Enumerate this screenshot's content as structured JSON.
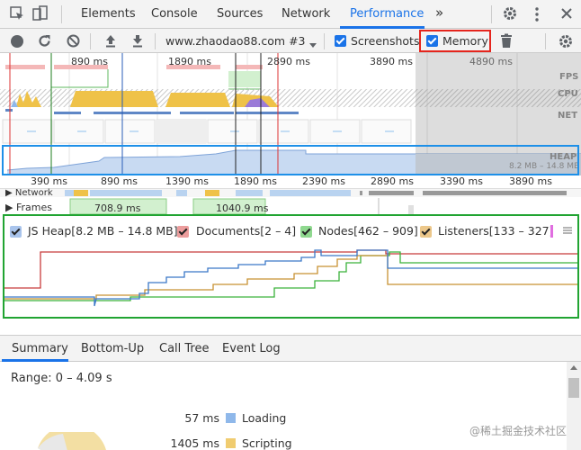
{
  "tabs": {
    "elements": "Elements",
    "console": "Console",
    "sources": "Sources",
    "network": "Network",
    "performance": "Performance",
    "more": "»"
  },
  "toolbar": {
    "recording_select": "www.zhaodao88.com #3",
    "screenshots_label": "Screenshots",
    "memory_label": "Memory",
    "screenshots_checked": true,
    "memory_checked": true
  },
  "overview": {
    "ticks_top": [
      "890 ms",
      "1890 ms",
      "2890 ms",
      "3890 ms",
      "4890 ms"
    ],
    "lanes": {
      "fps": "FPS",
      "cpu": "CPU",
      "net": "NET",
      "heap": "HEAP"
    },
    "heap_range": "8.2 MB – 14.8 MB"
  },
  "ruler": {
    "ticks": [
      "390 ms",
      "890 ms",
      "1390 ms",
      "1890 ms",
      "2390 ms",
      "2890 ms",
      "3390 ms",
      "3890 ms"
    ]
  },
  "tracks": {
    "network": "Network",
    "frames": "Frames",
    "frame1": "708.9 ms",
    "frame2": "1040.9 ms"
  },
  "counters": {
    "js_heap": "JS Heap[8.2 MB – 14.8 MB]",
    "documents": "Documents[2 – 4]",
    "nodes": "Nodes[462 – 909]",
    "listeners": "Listeners[133 – 327]",
    "colors": {
      "js_heap": "#3b78c8",
      "documents": "#c83b3b",
      "nodes": "#3bb23b",
      "listeners": "#c89132"
    }
  },
  "bottom_tabs": {
    "summary": "Summary",
    "bottom_up": "Bottom-Up",
    "call_tree": "Call Tree",
    "event_log": "Event Log"
  },
  "summary": {
    "range": "Range: 0 – 4.09 s",
    "rows": [
      {
        "value": "57 ms",
        "label": "Loading",
        "color": "#8fb8ea"
      },
      {
        "value": "1405 ms",
        "label": "Scripting",
        "color": "#f0cc70"
      }
    ]
  },
  "watermark": "@稀土掘金技术社区"
}
